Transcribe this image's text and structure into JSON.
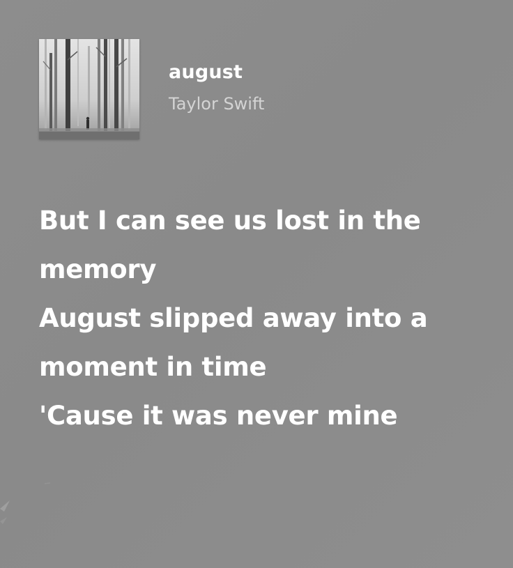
{
  "track": {
    "title": "august",
    "artist": "Taylor Swift"
  },
  "cover": {
    "icon": "album-cover-foggy-forest"
  },
  "lyrics": [
    "But I can see us lost in the",
    "memory",
    "August slipped away into a",
    "moment in time",
    "'Cause it was never mine"
  ],
  "colors": {
    "background": "#8b8b8b",
    "title": "#ffffff",
    "artist": "#d4d4d4",
    "lyrics": "#ffffff"
  }
}
